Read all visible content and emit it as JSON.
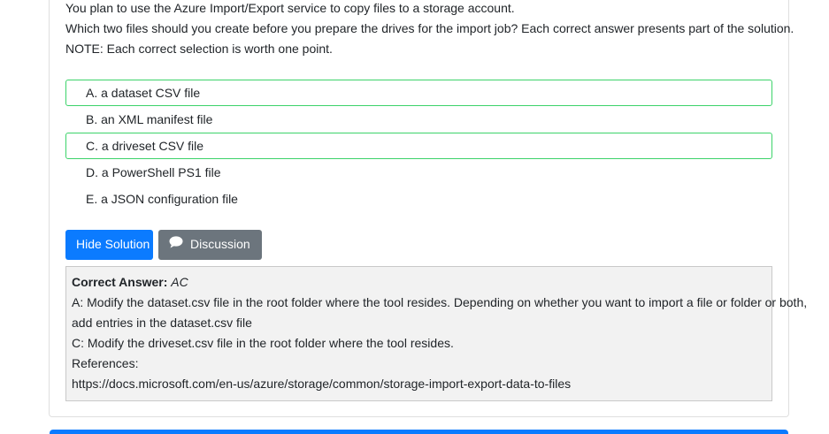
{
  "question": {
    "lines": [
      "You plan to use the Azure Import/Export service to copy files to a storage account.",
      "Which two files should you create before you prepare the drives for the import job? Each correct answer presents part of the solution.",
      "NOTE: Each correct selection is worth one point."
    ]
  },
  "choices": [
    {
      "label": "A. a dataset CSV file",
      "correct": true
    },
    {
      "label": "B. an XML manifest file",
      "correct": false
    },
    {
      "label": "C. a driveset CSV file",
      "correct": true
    },
    {
      "label": "D. a PowerShell PS1 file",
      "correct": false
    },
    {
      "label": "E. a JSON configuration file",
      "correct": false
    }
  ],
  "buttons": {
    "hide_solution": "Hide Solution",
    "discussion": "Discussion"
  },
  "solution": {
    "correct_label": "Correct Answer:",
    "correct_value": "AC",
    "lines": [
      "A: Modify the dataset.csv file in the root folder where the tool resides. Depending on whether you want to import a file or folder or both,",
      "add entries in the dataset.csv file",
      "C: Modify the driveset.csv file in the root folder where the tool resides.",
      "References:",
      "https://docs.microsoft.com/en-us/azure/storage/common/storage-import-export-data-to-files"
    ]
  },
  "colors": {
    "accent": "#0b7bff",
    "secondary": "#6c757d",
    "correct_border": "#3cd36a"
  }
}
